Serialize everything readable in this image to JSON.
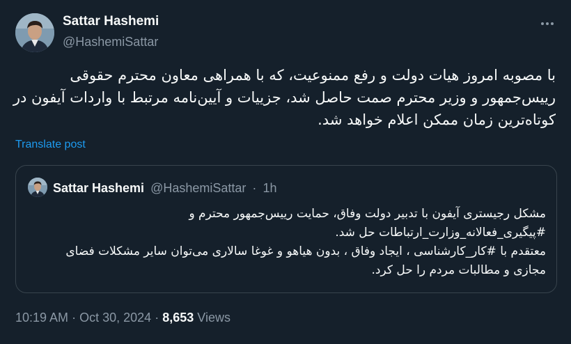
{
  "author": {
    "name": "Sattar Hashemi",
    "handle": "@HashemiSattar"
  },
  "icons": {
    "more": "more-horizontal-icon"
  },
  "tweet": {
    "text": "با مصوبه امروز هیات دولت و رفع ممنوعیت، که با همراهی معاون محترم حقوقی رییس‌جمهور و وزیر محترم صمت حاصل شد، جزییات و آیین‌نامه مرتبط با واردات آیفون در کوتاه‌ترین زمان ممکن اعلام خواهد شد.",
    "translate_label": "Translate post"
  },
  "quote": {
    "name": "Sattar Hashemi",
    "handle": "@HashemiSattar",
    "separator": "·",
    "time": "1h",
    "paragraphs": [
      "مشکل رجیستری آیفون با تدبیر دولت  وفاق، حمایت  رییس‌جمهور محترم و #پیگیری_فعالانه_وزارت_ارتباطات حل شد.",
      "معتقدم با #کار_کارشناسی ، ایجاد وفاق ، بدون هیاهو و غوغا سالاری می‌توان سایر مشکلات فضای مجازی و مطالبات مردم را حل کرد."
    ]
  },
  "footer": {
    "time": "10:19 AM",
    "separator": "·",
    "date": "Oct 30, 2024",
    "views_count": "8,653",
    "views_label": "Views"
  },
  "colors": {
    "background": "#15202b",
    "text": "#f7f9f9",
    "secondary": "#8b98a5",
    "link": "#1d9bf0",
    "border": "#38444d"
  }
}
